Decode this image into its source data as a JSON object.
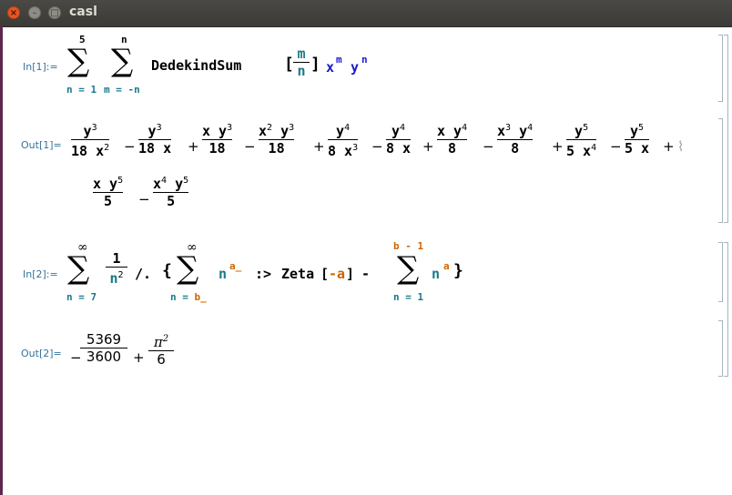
{
  "window": {
    "title": "casl"
  },
  "cells": {
    "in1": {
      "label": "In[1]:=",
      "outer_sum_upper": "5",
      "outer_sum_lower": "n = 1",
      "inner_sum_upper": "n",
      "inner_sum_lower": "m = -n",
      "func": "DedekindSum",
      "frac_num": "m",
      "frac_den": "n",
      "x": "x",
      "x_exp": "m",
      "y": "y",
      "y_exp": "n"
    },
    "out1": {
      "label": "Out[1]=",
      "terms": [
        {
          "num": "y3",
          "den": "18 x2"
        },
        {
          "num": "y3",
          "den": "18 x"
        },
        {
          "num": "x y3",
          "den": "18"
        },
        {
          "num": "x2 y3",
          "den": "18"
        },
        {
          "num": "y4",
          "den": "8 x3"
        },
        {
          "num": "y4",
          "den": "8 x"
        },
        {
          "num": "x y4",
          "den": "8"
        },
        {
          "num": "x3 y4",
          "den": "8"
        },
        {
          "num": "y5",
          "den": "5 x4"
        },
        {
          "num": "y5",
          "den": "5 x"
        },
        {
          "num": "x y5",
          "den": "5"
        },
        {
          "num": "x4 y5",
          "den": "5"
        }
      ]
    },
    "in2": {
      "label": "In[2]:=",
      "sum1_upper": "∞",
      "sum1_lower": "n = 7",
      "frac_num": "1",
      "frac_den": "n",
      "frac_den_exp": "2",
      "rule_op": "/.",
      "sum2_upper": "∞",
      "sum2_lower": "n = b_",
      "pow_base": "n",
      "pow_exp": "a_",
      "delayed": ":>",
      "zeta": "Zeta",
      "zeta_arg": "-a",
      "minus": "-",
      "sum3_upper": "b - 1",
      "sum3_lower": "n = 1",
      "pow2_base": "n",
      "pow2_exp": "a"
    },
    "out2": {
      "label": "Out[2]=",
      "frac1_num": "5369",
      "frac1_den": "3600",
      "frac2_num": "π",
      "frac2_num_exp": "2",
      "frac2_den": "6"
    }
  },
  "colors": {
    "accent_orange": "#e95420",
    "blue": "#1a1acc",
    "teal": "#1a7a8a",
    "pattern_orange": "#cc6600",
    "label_blue": "#36739b"
  }
}
